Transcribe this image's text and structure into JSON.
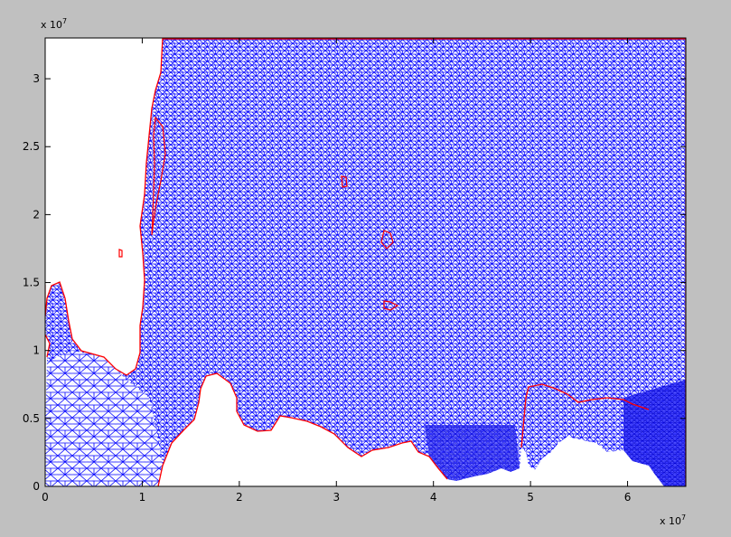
{
  "chart_data": {
    "type": "triangular-mesh",
    "title": "",
    "xlabel": "",
    "ylabel": "",
    "xlim": [
      0,
      6.6
    ],
    "ylim": [
      0,
      3.3
    ],
    "x_ticks": [
      0,
      1,
      2,
      3,
      4,
      5,
      6
    ],
    "y_ticks": [
      0,
      0.5,
      1,
      1.5,
      2,
      2.5,
      3
    ],
    "x_tick_labels": [
      "0",
      "1",
      "2",
      "3",
      "4",
      "5",
      "6"
    ],
    "y_tick_labels": [
      "0",
      "0.5",
      "1",
      "1.5",
      "2",
      "2.5",
      "3"
    ],
    "x_multiplier": "x 10",
    "x_exponent": "7",
    "y_multiplier": "x 10",
    "y_exponent": "7",
    "mesh_color": "#0000ff",
    "boundary_color": "#ff0000",
    "axes_background": "#ffffff",
    "figure_background": "#c0c0c0",
    "grid": false,
    "legend": "none"
  }
}
